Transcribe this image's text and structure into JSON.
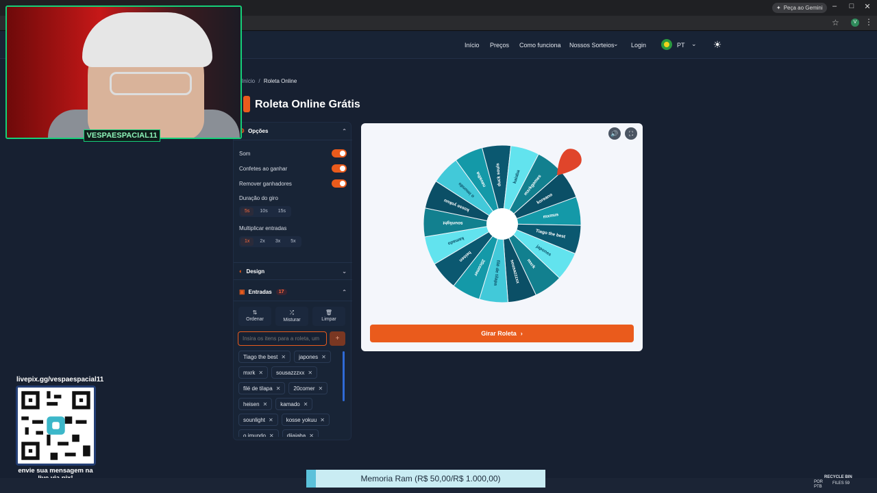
{
  "browser": {
    "gemini_label": "Peça ao Gemini",
    "profile_initial": "V"
  },
  "nav": {
    "links": [
      "Início",
      "Preços",
      "Como funciona",
      "Nossos Sorteios",
      "Login"
    ],
    "language": "PT"
  },
  "breadcrumb": {
    "home": "Início",
    "separator": "/",
    "current": "Roleta Online"
  },
  "page_title": "Roleta Online Grátis",
  "options": {
    "title": "Opções",
    "toggles": [
      {
        "label": "Som",
        "on": true
      },
      {
        "label": "Confetes ao ganhar",
        "on": true
      },
      {
        "label": "Remover ganhadores",
        "on": true
      }
    ],
    "duration_label": "Duração do giro",
    "durations": [
      "5s",
      "10s",
      "15s"
    ],
    "duration_selected": "5s",
    "multiply_label": "Multiplicar entradas",
    "multipliers": [
      "1x",
      "2x",
      "3x",
      "5x"
    ],
    "multiply_selected": "1x"
  },
  "design": {
    "title": "Design"
  },
  "entries": {
    "title": "Entradas",
    "count": "17",
    "actions": [
      "Ordenar",
      "Misturar",
      "Limpar"
    ],
    "input_placeholder": "Insira os itens para a roleta, um",
    "add_label": "+",
    "items": [
      "Tiago the best",
      "japones",
      "mxrk",
      "sousazzzxx",
      "filé de tilapa",
      "20comer",
      "heisen",
      "kamado",
      "sounlight",
      "kosse yokuu",
      "o imundo",
      "djiaiaba"
    ]
  },
  "wheel": {
    "segments": [
      "mxmus",
      "Tiago the best",
      "japones",
      "mxrk",
      "sousazzzxx",
      "filé de tilapa",
      "20comer",
      "heisen",
      "kamado",
      "sounlight",
      "kosse yokuu",
      "o imundo",
      "navalha",
      "duck souls",
      "kaiaba",
      "mxrkgomes",
      "koreano"
    ],
    "colors": [
      "#1499a8",
      "#0b5870",
      "#62e3ee",
      "#12808f",
      "#0b4f66",
      "#42c9d9"
    ],
    "spin_label": "Girar Roleta"
  },
  "overlay": {
    "streamer": "VESPAESPACIAL11",
    "pix_url": "livepix.gg/vespaespacial11",
    "pix_message": "envie sua mensagem na live via pix!",
    "ticker": "Memoria Ram (R$ 50,00/R$ 1.000,00)"
  },
  "taskbar": {
    "lang_top": "POR",
    "lang_bottom": "PTB",
    "recycle": "RECYCLE BIN",
    "files": "FILES 59"
  }
}
